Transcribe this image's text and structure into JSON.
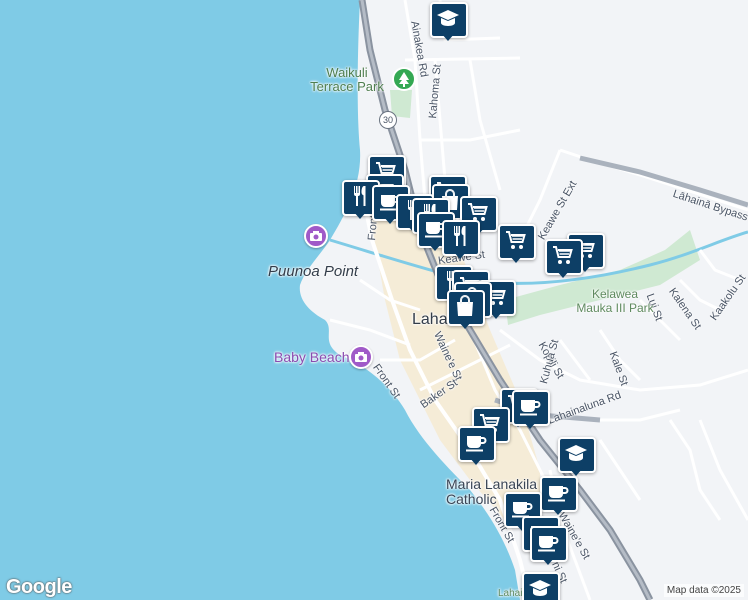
{
  "map": {
    "places": {
      "waikuli_terrace_park": "Waikuli Terrace Park",
      "puunoa_point": "Puunoa Point",
      "baby_beach": "Baby Beach",
      "lahaina_partial": "Laha",
      "kelawea_mauka_iii_park": "Kelawea Mauka III Park",
      "maria_lanakila_church": "Maria Lanakila Catholic",
      "bottom_partial": "Lahai"
    },
    "streets": {
      "ainakea_rd": "Ainakea Rd",
      "kahoma_st": "Kahoma St",
      "keawe_st_ext": "Keawe St Ext",
      "keawe_st": "Keawe St",
      "lahaina_bypass": "Lāhainā Bypass",
      "front_st_1": "Front",
      "front_st_2": "Front St",
      "front_st_3": "Front St",
      "waine_e_st_1": "Waine'e St",
      "waine_e_st_2": "Waine'e St",
      "baker_st": "Baker St",
      "kopili_st": "Kopili St",
      "kuhua_st": "Kuhua St",
      "kale_st": "Kale St",
      "lui_st": "Lui St",
      "kalena_st": "Kalena St",
      "kaakolu_st": "Kaakolu St",
      "lahainaluna_rd": "Lahainaluna Rd",
      "bottom_st": "ni St"
    },
    "route_shield": "30",
    "icons": {
      "restaurant": "fork-knife-icon",
      "grocery": "shopping-cart-icon",
      "cafe": "coffee-cup-icon",
      "shopping": "shopping-bag-icon",
      "school": "graduation-cap-icon",
      "camera": "camera-icon",
      "tree": "tree-icon"
    },
    "colors": {
      "water": "#7fcbe6",
      "land": "#f2f4f7",
      "highway": "#8a93a0",
      "downtown": "#f6ead1",
      "park": "#cfe9d2",
      "pin": "#0d3f66",
      "poi": "#a05ac8"
    },
    "attribution": {
      "logo": "Google",
      "map_data": "Map data ©2025"
    }
  }
}
